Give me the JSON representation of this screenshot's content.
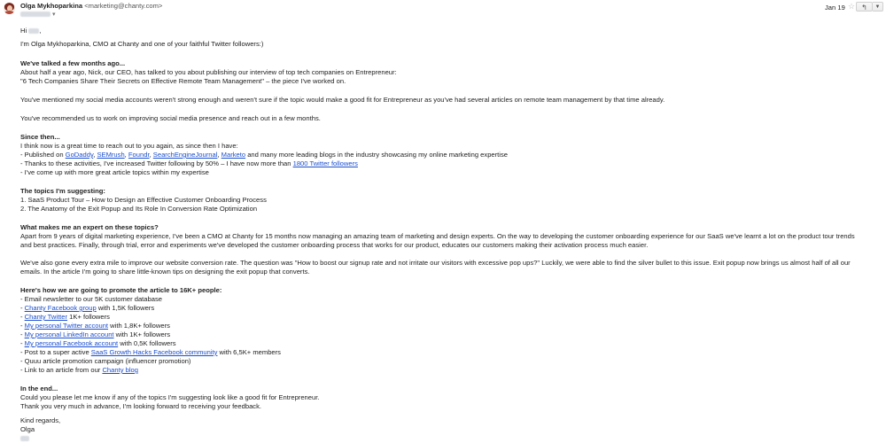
{
  "header": {
    "sender_name": "Olga Mykhoparkina",
    "sender_email": "<marketing@chanty.com>",
    "date": "Jan 19",
    "reply_icon": "reply-icon",
    "star_icon": "star-icon",
    "more_icon": "chevron-down-icon"
  },
  "body": {
    "greeting": "Hi",
    "intro": "I'm Olga Mykhoparkina, CMO at Chanty and one of your faithful Twitter followers:)",
    "s1_heading": "We've talked a few months ago...",
    "s1_l1": "About half a year ago, Nick, our CEO, has talked to you about publishing our interview of top tech companies on Entrepreneur:",
    "s1_l2": "\"6 Tech Companies Share Their Secrets on Effective Remote Team Management\" – the piece I've worked on.",
    "s1_p2": "You've mentioned my social media accounts weren't strong enough and weren't sure if the topic would make a good fit for Entrepreneur as you've had several articles on remote team management by that time already.",
    "s1_p3": "You've recommended us to work on improving social media presence and reach out in a few months.",
    "s2_heading": "Since then...",
    "s2_l1": "I think now is a great time to reach out to you again, as since then I have:",
    "s2_l2_pre": "- Published on ",
    "s2_links": [
      "GoDaddy",
      "SEMrush",
      "Foundr",
      "SearchEngineJournal",
      "Marketo"
    ],
    "s2_l2_post": " and many more leading blogs in the industry showcasing my online marketing expertise",
    "s2_l3_pre": "- Thanks to these activities, I've increased Twitter following by 50% – I have now more than ",
    "s2_l3_link": "1800 Twitter followers",
    "s2_l4": "- I've come up with more great article topics within my expertise",
    "s3_heading": "The topics I'm suggesting:",
    "s3_l1": "1. SaaS Product Tour – How to Design an Effective Customer Onboarding Process",
    "s3_l2": "2. The Anatomy of the Exit Popup and Its Role In Conversion Rate Optimization",
    "s4_heading": "What makes me an expert on these topics?",
    "s4_l1": "Apart from 9 years of digital marketing experience, I've been a CMO at Chanty for 15 months now managing an amazing team of marketing and design experts. On the way to developing the customer onboarding experience for our SaaS we've learnt a lot on the product tour trends",
    "s4_l2": "and best practices. Finally, through trial, error and experiments we've developed the customer onboarding process that works for our product, educates our customers making their activation process much easier.",
    "s4_l3": "We've also gone every extra mile to improve our website conversion rate. The question was \"How to boost our signup rate and not irritate our visitors with excessive pop ups?\" Luckily, we were able to find the silver bullet to this issue. Exit popup now brings us almost half of all our",
    "s4_l4": "emails. In the article I'm going to share little-known tips on designing the exit popup that converts.",
    "s5_heading": "Here's how we are going to promote the article to 16K+ people:",
    "s5_l1": "- Email newsletter to our 5K customer database",
    "s5_items": [
      {
        "pre": "- ",
        "link": "Chanty Facebook group",
        "post": " with 1,5K followers"
      },
      {
        "pre": "- ",
        "link": "Chanty Twitter",
        "post": " 1K+ followers"
      },
      {
        "pre": "- ",
        "link": "My personal Twitter account",
        "post": " with 1,8K+ followers"
      },
      {
        "pre": "- ",
        "link": "My personal LinkedIn account",
        "post": " with 1K+ followers"
      },
      {
        "pre": "- ",
        "link": "My personal Facebook account",
        "post": " with 0,5K followers"
      },
      {
        "pre": "- Post to a super active ",
        "link": "SaaS Growth Hacks Facebook community",
        "post": " with 6,5K+ members"
      }
    ],
    "s5_l8": "- Quuu article promotion campaign (influencer promotion)",
    "s5_l9_pre": "- Link to an article from our ",
    "s5_l9_link": "Chanty blog",
    "s6_heading": "In the end...",
    "s6_l1": "Could you please let me know if any of the topics I'm suggesting look like a good fit for Entrepreneur.",
    "s6_l2": "Thank you very much in advance, I'm looking forward to receiving your feedback.",
    "closing": "Kind regards,",
    "signature": "Olga"
  }
}
